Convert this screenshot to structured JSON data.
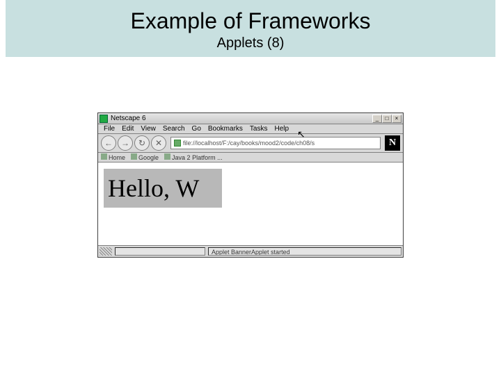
{
  "slide": {
    "title": "Example of Frameworks",
    "subtitle": "Applets (8)"
  },
  "window": {
    "title": "Netscape 6",
    "btn_min": "_",
    "btn_max": "□",
    "btn_close": "×"
  },
  "menu": {
    "file": "File",
    "edit": "Edit",
    "view": "View",
    "search": "Search",
    "go": "Go",
    "bookmarks": "Bookmarks",
    "tasks": "Tasks",
    "help": "Help"
  },
  "nav": {
    "back": "←",
    "forward": "→",
    "reload": "↻",
    "stop": "✕",
    "url": "file://localhost/F:/cay/books/mood2/code/ch08/s",
    "logo": "N"
  },
  "bookmarks": {
    "home": "Home",
    "google": "Google",
    "java": "Java 2 Platform ..."
  },
  "applet": {
    "text": "Hello, W"
  },
  "status": {
    "text": "Applet BannerApplet started"
  }
}
